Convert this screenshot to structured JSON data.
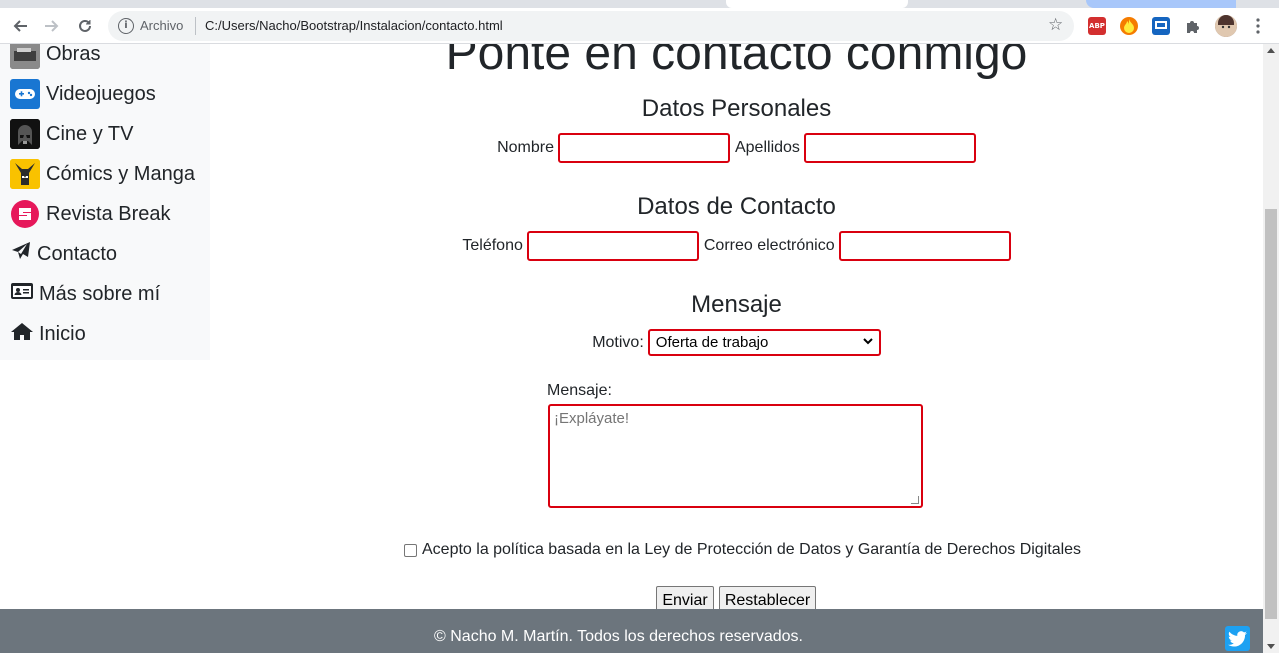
{
  "browser": {
    "scheme_label": "Archivo",
    "url": "C:/Users/Nacho/Bootstrap/Instalacion/contacto.html",
    "extensions": [
      "ABP"
    ]
  },
  "sidebar": {
    "items": [
      {
        "label": "Obras",
        "icon": "obras-thumbnail-icon"
      },
      {
        "label": "Videojuegos",
        "icon": "gamepad-icon"
      },
      {
        "label": "Cine y TV",
        "icon": "darth-vader-icon"
      },
      {
        "label": "Cómics y Manga",
        "icon": "wolverine-icon"
      },
      {
        "label": "Revista Break",
        "icon": "break-logo-icon"
      },
      {
        "label": "Contacto",
        "icon": "paper-plane-icon"
      },
      {
        "label": "Más sobre mí",
        "icon": "id-card-icon"
      },
      {
        "label": "Inicio",
        "icon": "home-icon"
      }
    ]
  },
  "main": {
    "title": "Ponte en contacto conmigo",
    "personal": {
      "heading": "Datos Personales",
      "nombre_label": "Nombre",
      "apellidos_label": "Apellidos"
    },
    "contact": {
      "heading": "Datos de Contacto",
      "telefono_label": "Teléfono",
      "email_label": "Correo electrónico"
    },
    "message": {
      "heading": "Mensaje",
      "motivo_label": "Motivo:",
      "motivo_selected": "Oferta de trabajo",
      "mensaje_label": "Mensaje:",
      "mensaje_placeholder": "¡Expláyate!"
    },
    "consent_text": "Acepto la política basada en la Ley de Protección de Datos y Garantía de Derechos Digitales",
    "submit_label": "Enviar",
    "reset_label": "Restablecer"
  },
  "footer": {
    "copyright": "© Nacho M. Martín. Todos los derechos reservados."
  },
  "colors": {
    "input_border": "#d9000f",
    "footer_bg": "#6c757d",
    "sidebar_bg": "#f8f9fa",
    "twitter": "#1da1f2"
  }
}
